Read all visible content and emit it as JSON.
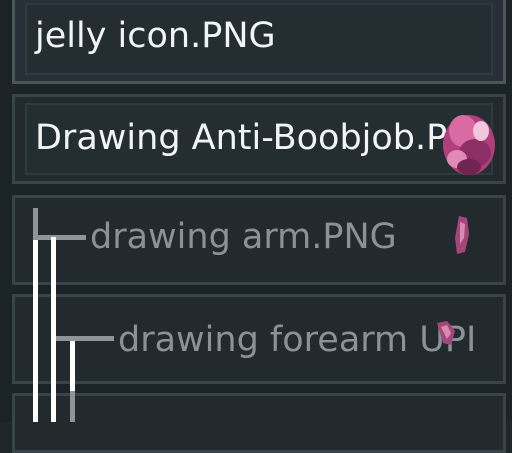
{
  "layers": [
    {
      "label": "jelly icon.PNG",
      "thumbnail": "none",
      "state": "selected"
    },
    {
      "label": "Drawing Anti-Boobjob.PN",
      "thumbnail": "pink-figure-thumbnail"
    },
    {
      "label": "drawing arm.PNG",
      "thumbnail": "pink-arm-thumbnail",
      "state": "child-level-1"
    },
    {
      "label": "drawing forearm UPI",
      "thumbnail": "pink-forearm-thumbnail",
      "state": "child-level-2"
    }
  ],
  "colors": {
    "background": "#1c2326",
    "row_border": "#39444a",
    "text_primary": "#f1f4f5",
    "text_dimmed": "#8a9296",
    "thumb_pink": "#c9558f"
  }
}
